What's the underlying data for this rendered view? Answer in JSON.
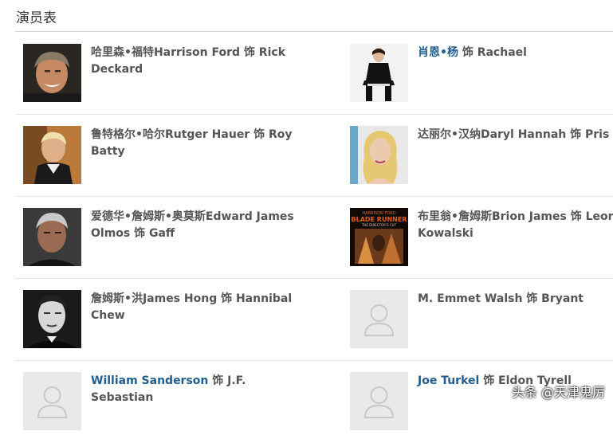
{
  "section": {
    "title": "演员表"
  },
  "cast": [
    {
      "actor": "哈里森•福特Harrison Ford",
      "role": "饰 Rick Deckard"
    },
    {
      "actor": "肖恩•杨",
      "role": "饰 Rachael"
    },
    {
      "actor": "鲁特格尔•哈尔Rutger Hauer",
      "role": "饰 Roy Batty"
    },
    {
      "actor": "达丽尔•汉纳Daryl Hannah",
      "role": "饰 Pris"
    },
    {
      "actor": "爱德华•詹姆斯•奥莫斯Edward James Olmos",
      "role": "饰 Gaff"
    },
    {
      "actor": "布里翁•詹姆斯Brion James",
      "role": "饰 Leon Kowalski"
    },
    {
      "actor": "詹姆斯•洪James Hong",
      "role": "饰 Hannibal Chew"
    },
    {
      "actor": "M. Emmet Walsh",
      "role": "饰 Bryant"
    },
    {
      "actor": "William Sanderson",
      "role": "饰 J.F. Sebastian"
    },
    {
      "actor": "Joe Turkel",
      "role": "饰 Eldon Tyrell"
    }
  ],
  "poster": {
    "line1": "HARRISON FORD",
    "title": "BLADE RUNNER",
    "subtitle": "THE DIRECTOR'S CUT"
  },
  "watermark": "头条 @天津鬼厉"
}
